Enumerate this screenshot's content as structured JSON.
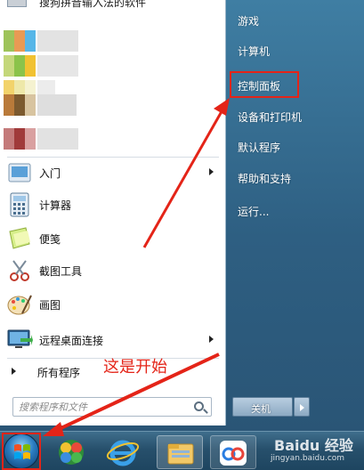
{
  "start_menu": {
    "pinned_top_partial": "搜狗拼音输入法的软件",
    "left_items": [
      {
        "id": "getting-started",
        "label": "入门",
        "has_arrow": true
      },
      {
        "id": "calculator",
        "label": "计算器"
      },
      {
        "id": "sticky-notes",
        "label": "便笺"
      },
      {
        "id": "snipping-tool",
        "label": "截图工具"
      },
      {
        "id": "paint",
        "label": "画图"
      },
      {
        "id": "remote-desktop",
        "label": "远程桌面连接",
        "has_arrow": true
      }
    ],
    "all_programs_label": "所有程序",
    "search_placeholder": "搜索程序和文件",
    "right_items": [
      {
        "id": "games",
        "label": "游戏"
      },
      {
        "id": "computer",
        "label": "计算机"
      },
      {
        "id": "control-panel",
        "label": "控制面板",
        "highlighted": true
      },
      {
        "id": "devices-printers",
        "label": "设备和打印机"
      },
      {
        "id": "default-programs",
        "label": "默认程序"
      },
      {
        "id": "help-support",
        "label": "帮助和支持"
      },
      {
        "id": "run",
        "label": "运行..."
      }
    ],
    "shutdown_label": "关机"
  },
  "annotation": {
    "text": "这是开始",
    "color": "#e42418"
  },
  "taskbar": {
    "apps": [
      "start-orb",
      "360-security-icon",
      "ie-browser-icon",
      "file-explorer-icon",
      "baidu-netdisk-icon"
    ]
  },
  "watermark": {
    "logo": "Baidu 经验",
    "url": "jingyan.baidu.com"
  },
  "colors": {
    "accent_red": "#e42418",
    "menu_blue": "#2e5f82",
    "taskbar_blue": "#27506c"
  }
}
